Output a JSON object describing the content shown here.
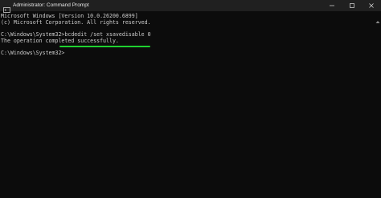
{
  "window": {
    "title": "Administrator: Command Prompt",
    "icon": "command-prompt-icon",
    "controls": [
      "minimize-icon",
      "maximize-icon",
      "close-icon"
    ]
  },
  "console": {
    "lines": [
      "Microsoft Windows [Version 10.0.26200.6899]",
      "(c) Microsoft Corporation. All rights reserved.",
      "C:\\Windows\\System32>bcdedit /set xsavedisable 0",
      "The operation completed successfully.",
      "C:\\Windows\\System32>"
    ],
    "highlight_color": "#1fd130",
    "text_color": "#cccccc",
    "background_color": "#0c0c0c"
  }
}
